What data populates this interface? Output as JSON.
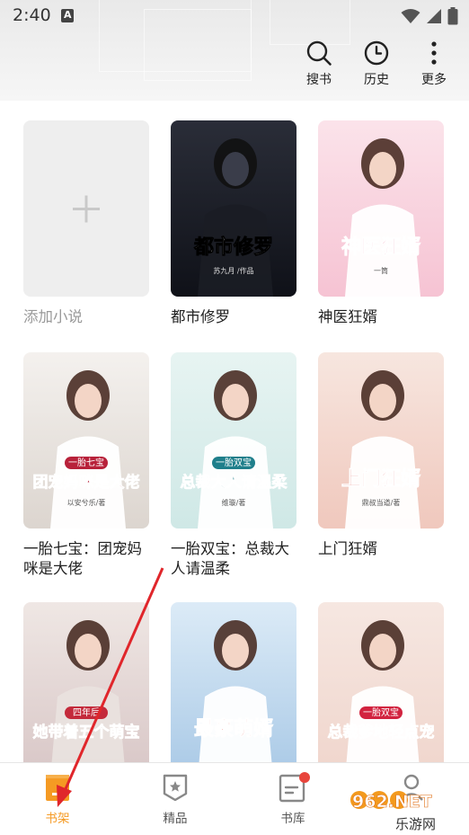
{
  "status_bar": {
    "time": "2:40"
  },
  "header": {
    "actions": [
      {
        "icon": "search-icon",
        "label": "搜书"
      },
      {
        "icon": "clock-icon",
        "label": "历史"
      },
      {
        "icon": "more-vertical-icon",
        "label": "更多"
      }
    ]
  },
  "shelf": {
    "add_label": "添加小说",
    "books": [
      {
        "title": "都市修罗",
        "cover_text": "都市修罗",
        "cover_author": "苏九月 /作品",
        "palette": [
          "#2a2d38",
          "#0f1118"
        ],
        "accent": "#f2f2f2"
      },
      {
        "title": "神医狂婿",
        "cover_text": "神医狂婿",
        "cover_author": "一筒",
        "palette": [
          "#fbe3ea",
          "#f6c3d3"
        ],
        "accent": "#d81e4d"
      },
      {
        "title": "一胎七宝：团宠妈咪是大佬",
        "cover_text": "团宠妈咪是大佬",
        "cover_badge": "一胎七宝",
        "cover_author": "以安兮乐/著",
        "palette": [
          "#f4f1ee",
          "#dcd5cf"
        ],
        "accent": "#b8213a"
      },
      {
        "title": "一胎双宝：总裁大人请温柔",
        "cover_text": "总裁大人请温柔",
        "cover_badge": "一胎双宝",
        "cover_author": "维璇/著",
        "palette": [
          "#e7f4f2",
          "#cfe8e6"
        ],
        "accent": "#1f7f8b"
      },
      {
        "title": "上门狂婿",
        "cover_text": "上门狂婿",
        "cover_author": "鼎叔当道/著",
        "palette": [
          "#f7e6df",
          "#f0c8bd"
        ],
        "accent": "#d4261f"
      },
      {
        "title": "",
        "cover_text": "她带着五个萌宝",
        "cover_badge": "四年后",
        "palette": [
          "#efe7e4",
          "#d8c6c6"
        ],
        "accent": "#c42a3b"
      },
      {
        "title": "",
        "cover_text": "最豪萌婿",
        "palette": [
          "#dcebf7",
          "#a9c9e6"
        ],
        "accent": "#d8261c"
      },
      {
        "title": "",
        "cover_text": "总裁爹地轻点宠",
        "cover_badge": "一胎双宝",
        "palette": [
          "#f6e7e1",
          "#f0d5cc"
        ],
        "accent": "#d2233f"
      }
    ]
  },
  "bottom_nav": [
    {
      "icon": "bookshelf-icon",
      "label": "书架",
      "active": true
    },
    {
      "icon": "featured-badge-icon",
      "label": "精品",
      "active": false
    },
    {
      "icon": "library-icon",
      "label": "书库",
      "active": false
    },
    {
      "icon": "profile-icon",
      "label": "",
      "active": false
    }
  ],
  "watermark": {
    "text": "962.NET",
    "subtext": "乐游网"
  },
  "colors": {
    "accent": "#f59a23",
    "arrow": "#e0262b",
    "badge": "#e8453c"
  }
}
